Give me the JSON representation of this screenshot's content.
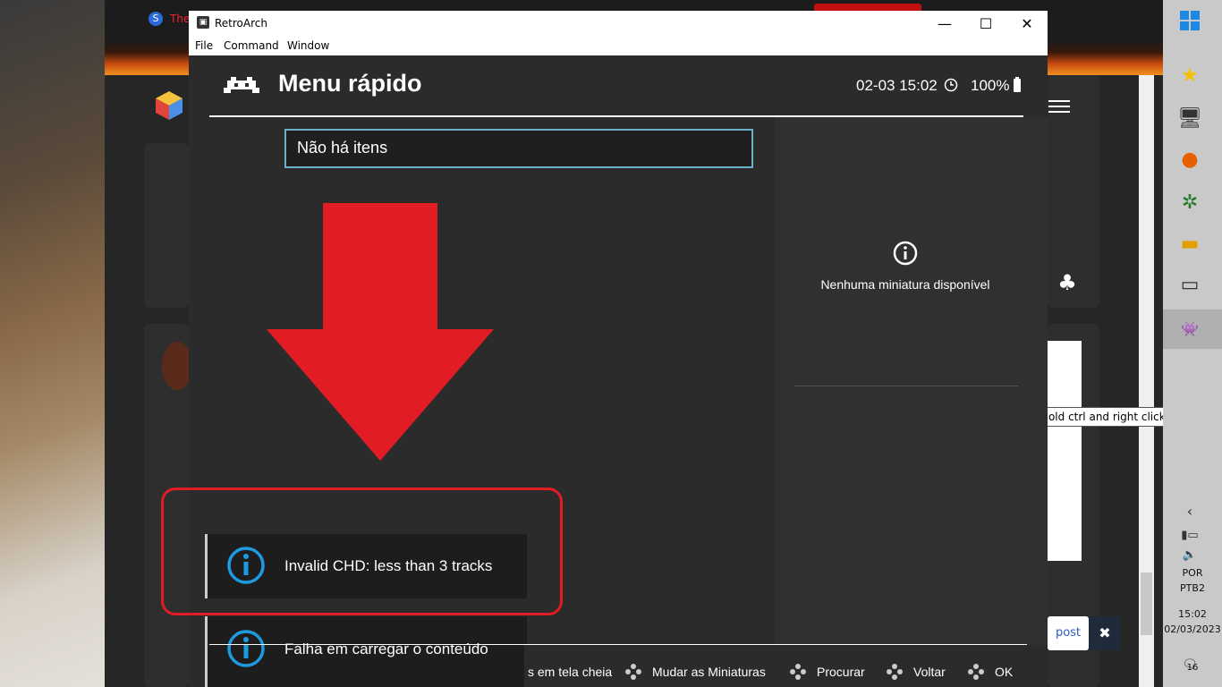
{
  "window": {
    "title": "RetroArch",
    "menu": [
      "File",
      "Command",
      "Window"
    ],
    "controls": [
      "minimize-icon",
      "maximize-icon",
      "close-icon"
    ]
  },
  "header": {
    "title": "Menu rápido",
    "datetime": "02-03 15:02",
    "battery": "100%"
  },
  "search": {
    "text": "Não há itens"
  },
  "thumbnail": {
    "message": "Nenhuma miniatura disponível"
  },
  "notifications": [
    {
      "text": "Invalid CHD: less than 3 tracks"
    },
    {
      "text": "Falha em carregar o conteúdo"
    }
  ],
  "footer": {
    "items": [
      "s em tela cheia",
      "Mudar as Miniaturas",
      "Procurar",
      "Voltar",
      "OK"
    ]
  },
  "background_browser": {
    "tab_title": "The",
    "tooltip": "Enter your text; hold ctrl and right click for more options",
    "post_button": "post"
  },
  "taskbar": {
    "language": "POR",
    "layout": "PTB2",
    "time": "15:02",
    "date": "02/03/2023",
    "notification_count": "16"
  },
  "colors": {
    "accent_arrow": "#e21c24",
    "search_border": "#6ab0c8",
    "info_icon": "#1e9ae0",
    "bg": "#2b2b2b"
  }
}
